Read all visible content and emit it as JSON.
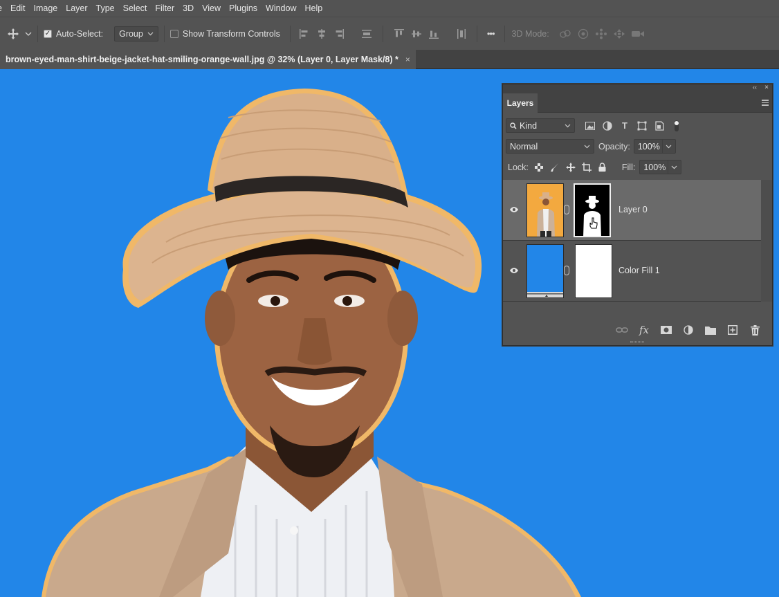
{
  "menu": [
    "e",
    "Edit",
    "Image",
    "Layer",
    "Type",
    "Select",
    "Filter",
    "3D",
    "View",
    "Plugins",
    "Window",
    "Help"
  ],
  "options_bar": {
    "tool_icon": "move-tool-icon",
    "auto_select_label": "Auto-Select:",
    "auto_select_checked": true,
    "auto_select_target": "Group",
    "show_transform_label": "Show Transform Controls",
    "show_transform_checked": false,
    "more_label": "•••",
    "mode_3d_label": "3D Mode:"
  },
  "document_tab": {
    "title": "brown-eyed-man-shirt-beige-jacket-hat-smiling-orange-wall.jpg @ 32% (Layer 0, Layer Mask/8) *",
    "close": "×"
  },
  "canvas": {
    "background_color": "#2286e8"
  },
  "layers_panel": {
    "tab_label": "Layers",
    "collapse_glyph": "‹‹",
    "close_glyph": "×",
    "filter_kind": "Kind",
    "blend_mode": "Normal",
    "opacity_label": "Opacity:",
    "opacity_value": "100%",
    "lock_label": "Lock:",
    "fill_label": "Fill:",
    "fill_value": "100%",
    "layers": [
      {
        "name": "Layer 0",
        "visible": true,
        "selected": true
      },
      {
        "name": "Color Fill 1",
        "visible": true,
        "selected": false
      }
    ],
    "footer_icons": [
      "link-layers-icon",
      "fx-icon",
      "add-mask-icon",
      "adjustment-layer-icon",
      "new-group-icon",
      "new-layer-icon",
      "delete-layer-icon"
    ],
    "fx_label": "fx"
  }
}
